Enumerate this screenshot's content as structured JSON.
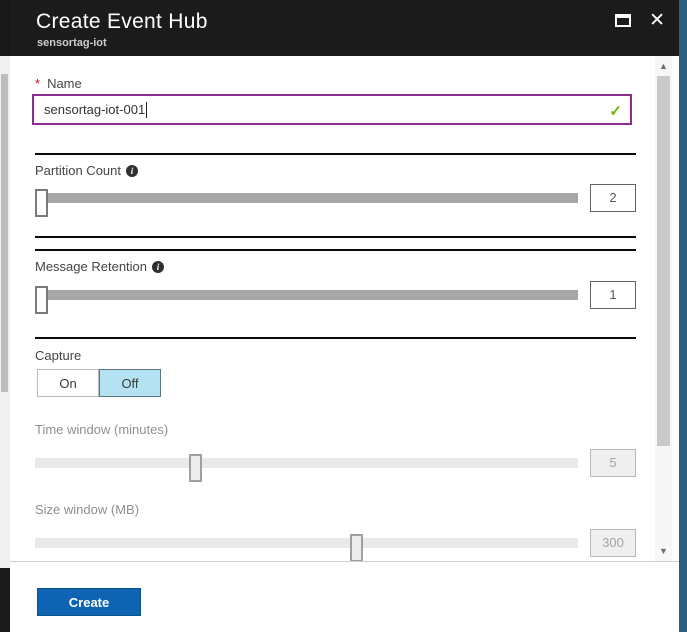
{
  "header": {
    "title": "Create Event Hub",
    "subtitle": "sensortag-iot",
    "maximize_icon": "window-maximize",
    "close_icon": "✕"
  },
  "form": {
    "name": {
      "required_marker": "*",
      "label": "Name",
      "value": "sensortag-iot-001",
      "valid_icon": "✓"
    },
    "partition_count": {
      "label": "Partition Count",
      "info_icon": "i",
      "value": "2",
      "slider_left_percent": 0,
      "disabled": false
    },
    "message_retention": {
      "label": "Message Retention",
      "info_icon": "i",
      "value": "1",
      "slider_left_percent": 0,
      "disabled": false
    },
    "capture": {
      "label": "Capture",
      "on_label": "On",
      "off_label": "Off",
      "selected": "Off"
    },
    "time_window": {
      "label": "Time window (minutes)",
      "value": "5",
      "slider_left_percent": 28.3,
      "disabled": true
    },
    "size_window": {
      "label": "Size window (MB)",
      "value": "300",
      "slider_left_percent": 58.1,
      "disabled": true
    }
  },
  "scrollbar": {
    "up_arrow": "▲",
    "down_arrow": "▼"
  },
  "footer": {
    "create_label": "Create"
  },
  "colors": {
    "header_bg": "#1b1b1b",
    "name_border": "#8f2d8f",
    "valid_green": "#71af11",
    "off_selected_bg": "#b4e2f2",
    "create_button_bg": "#0e63b3",
    "right_strip": "#2e5d7d",
    "active_track": "#a7a7a7",
    "disabled_track": "#e9e9e9"
  }
}
